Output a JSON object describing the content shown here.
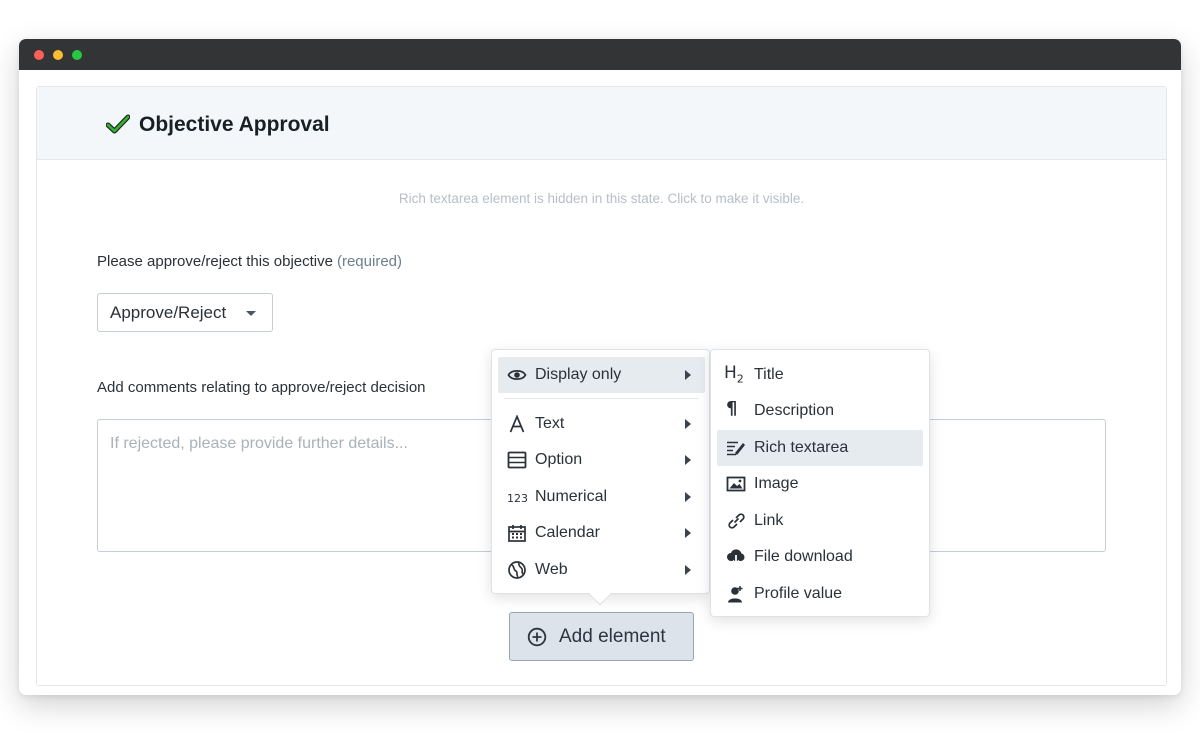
{
  "card": {
    "title": "Objective Approval"
  },
  "hint": "Rich textarea element is hidden in this state. Click to make it visible.",
  "question1": {
    "label": "Please approve/reject this objective",
    "required": "(required)"
  },
  "select": {
    "value": "Approve/Reject"
  },
  "question2": {
    "label": "Add comments relating to approve/reject decision"
  },
  "comments": {
    "placeholder": "If rejected, please provide further details..."
  },
  "add_button": {
    "label": "Add element"
  },
  "menu": {
    "items": [
      {
        "label": "Display only",
        "icon": "eye-icon"
      },
      {
        "label": "Text",
        "icon": "letter-a-icon"
      },
      {
        "label": "Option",
        "icon": "list-icon"
      },
      {
        "label": "Numerical",
        "icon": "numbers-icon"
      },
      {
        "label": "Calendar",
        "icon": "calendar-icon"
      },
      {
        "label": "Web",
        "icon": "globe-icon"
      }
    ],
    "numerical_glyph": "123"
  },
  "submenu": {
    "items": [
      {
        "label": "Title",
        "icon": "heading-icon"
      },
      {
        "label": "Description",
        "icon": "paragraph-icon"
      },
      {
        "label": "Rich textarea",
        "icon": "rich-text-icon"
      },
      {
        "label": "Image",
        "icon": "image-icon"
      },
      {
        "label": "Link",
        "icon": "link-icon"
      },
      {
        "label": "File download",
        "icon": "cloud-download-icon"
      },
      {
        "label": "Profile value",
        "icon": "user-icon"
      }
    ],
    "heading_glyph": "H",
    "heading_sub": "2",
    "paragraph_glyph": "¶"
  },
  "colors": {
    "accent": "#28a745",
    "active_bg": "#e6ebf0",
    "button_bg": "#dde3ea"
  }
}
